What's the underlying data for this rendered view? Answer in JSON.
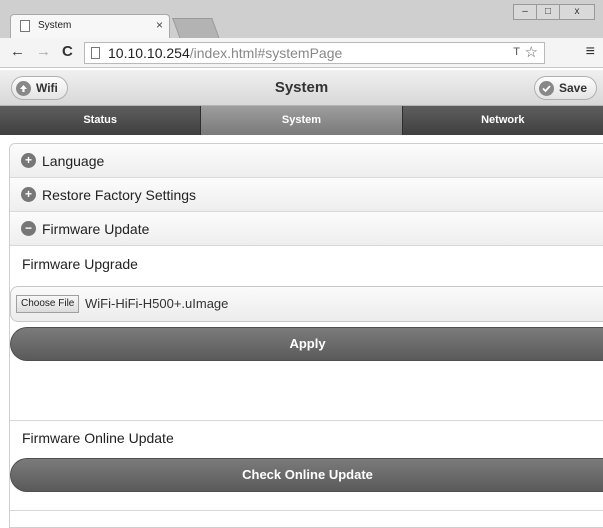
{
  "browser": {
    "tab_title": "System",
    "tab_close": "×",
    "window_controls": {
      "minimize": "–",
      "maximize": "□",
      "close": "x"
    },
    "nav": {
      "back": "←",
      "forward": "→",
      "reload": "C"
    },
    "url_host": "10.10.10.254",
    "url_path": "/index.html#systemPage",
    "translate_icon": "T",
    "star_icon": "☆",
    "menu_icon": "≡"
  },
  "header": {
    "back_button": {
      "label": "Wifi",
      "icon": "arrow-up-icon"
    },
    "title": "System",
    "save_button": {
      "label": "Save",
      "icon": "check-icon"
    }
  },
  "navbar": {
    "tabs": [
      {
        "label": "Status",
        "active": false
      },
      {
        "label": "System",
        "active": true
      },
      {
        "label": "Network",
        "active": false
      }
    ]
  },
  "sections": [
    {
      "label": "Language",
      "expanded": false,
      "icon": "plus-icon"
    },
    {
      "label": "Restore Factory Settings",
      "expanded": false,
      "icon": "plus-icon"
    },
    {
      "label": "Firmware Update",
      "expanded": true,
      "icon": "minus-icon"
    }
  ],
  "firmware": {
    "upgrade_label": "Firmware Upgrade",
    "choose_file_label": "Choose File",
    "file_name": "WiFi-HiFi-H500+.uImage",
    "apply_label": "Apply",
    "online_label": "Firmware Online Update",
    "check_label": "Check Online Update"
  },
  "colors": {
    "nav_active": "#8a8a8a",
    "nav_inactive": "#4a4a4a",
    "button_dark": "#6a6a6a"
  }
}
